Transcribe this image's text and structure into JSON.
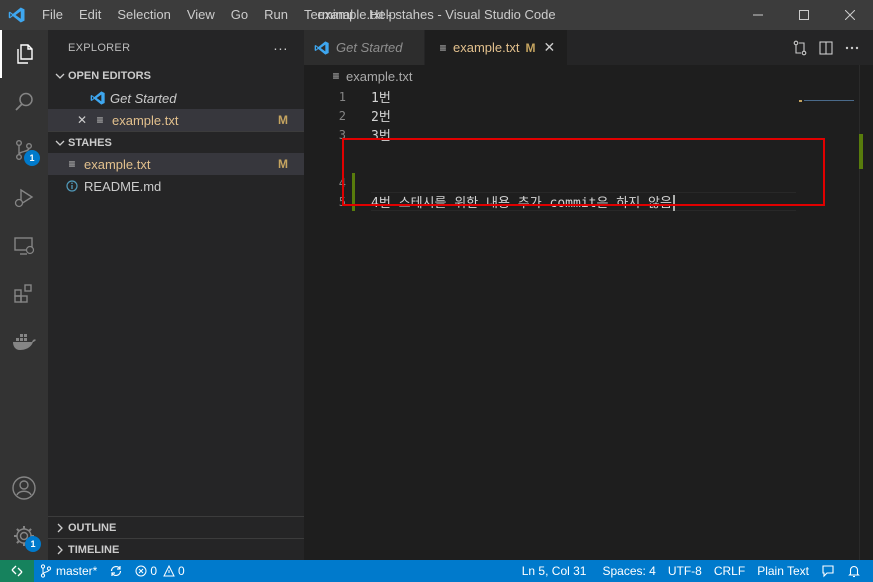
{
  "titlebar": {
    "menu": [
      "File",
      "Edit",
      "Selection",
      "View",
      "Go",
      "Run",
      "Terminal",
      "Help"
    ],
    "title": "example.txt - stahes - Visual Studio Code",
    "minimize": "🗕",
    "maximize": "☐",
    "close": "✕"
  },
  "activitybar": {
    "items": [
      "explorer-icon",
      "search-icon",
      "source-control-icon",
      "run-debug-icon",
      "remote-explorer-icon",
      "extensions-icon",
      "docker-icon",
      "accounts-icon",
      "manage-gear-icon"
    ],
    "source_control_badge": "1",
    "manage_badge": "1"
  },
  "sidebar": {
    "header": "EXPLORER",
    "more": "···",
    "open_editors": {
      "title": "OPEN EDITORS",
      "items": [
        {
          "label": "Get Started",
          "icon": "vscode-icon"
        },
        {
          "label": "example.txt",
          "icon": "text-file-icon",
          "status": "M",
          "close": "✕"
        }
      ]
    },
    "folder": {
      "title": "STAHES",
      "items": [
        {
          "label": "example.txt",
          "icon": "text-file-icon",
          "status": "M"
        },
        {
          "label": "README.md",
          "icon": "info-icon"
        }
      ]
    },
    "outline": "OUTLINE",
    "timeline": "TIMELINE"
  },
  "editor": {
    "tabs": [
      {
        "label": "Get Started",
        "active": false
      },
      {
        "label": "example.txt",
        "active": true,
        "status": "M",
        "close": "✕"
      }
    ],
    "breadcrumb": "example.txt",
    "lines": [
      {
        "number": "1",
        "text": "1번"
      },
      {
        "number": "2",
        "text": "2번"
      },
      {
        "number": "3",
        "text": "3번"
      },
      {
        "number": "4",
        "text": ""
      },
      {
        "number": "5",
        "text": "4번 스테시를 위한 내용 추가 commit은 하지 않음"
      }
    ],
    "colors": {
      "modified": "#e2c08d",
      "added_gutter": "#587c0c",
      "highlight_box": "#e00000"
    }
  },
  "statusbar": {
    "branch": "master*",
    "errors": "0",
    "warnings": "0",
    "position": "Ln 5, Col 31",
    "spaces": "Spaces: 4",
    "encoding": "UTF-8",
    "eol": "CRLF",
    "language": "Plain Text",
    "color": "#007acc"
  }
}
